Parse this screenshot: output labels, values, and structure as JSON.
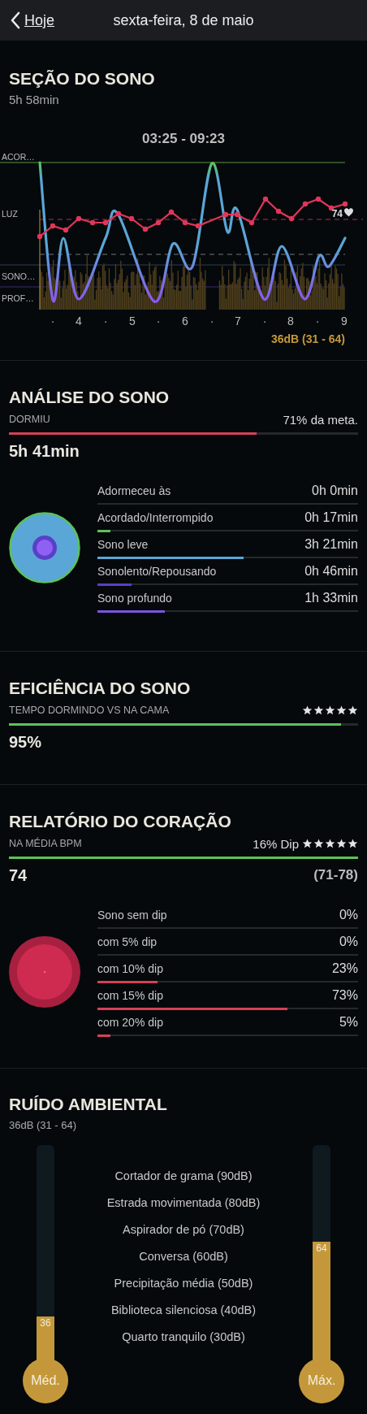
{
  "header": {
    "back": "Hoje",
    "title": "sexta-feira, 8 de maio"
  },
  "session": {
    "title": "SEÇÃO DO SONO",
    "duration": "5h 58min",
    "time_range": "03:25 - 09:23",
    "y_labels": [
      "ACOR…",
      "LUZ",
      "SONO…",
      "PROF…"
    ],
    "heart_rate_label": "74",
    "x_ticks": [
      "·",
      "4",
      "·",
      "5",
      "·",
      "6",
      "·",
      "7",
      "·",
      "8",
      "·",
      "9"
    ],
    "noise_label": "36dB (31 - 64)"
  },
  "analysis": {
    "title": "ANÁLISE DO SONO",
    "metric_label": "DORMIU",
    "goal": "71% da meta.",
    "level": 0.71,
    "value": "5h 41min",
    "stages": [
      {
        "label": "Adormeceu às",
        "value": "0h 0min"
      },
      {
        "label": "Acordado/Interrompido",
        "value": "0h 17min",
        "level": 0.05,
        "color": "#5cc25a"
      },
      {
        "label": "Sono leve",
        "value": "3h 21min",
        "level": 0.56,
        "color": "#5aa6d6"
      },
      {
        "label": "Sonolento/Repousando",
        "value": "0h 46min",
        "level": 0.13,
        "color": "#5a3fc8"
      },
      {
        "label": "Sono profundo",
        "value": "1h 33min",
        "level": 0.26,
        "color": "#7b55e0"
      }
    ]
  },
  "efficiency": {
    "title": "EFICIÊNCIA DO SONO",
    "metric_label": "TEMPO DORMINDO VS NA CAMA",
    "stars": 5,
    "level": 0.95,
    "value": "95%"
  },
  "heart": {
    "title": "RELATÓRIO DO CORAÇÃO",
    "metric_label": "NA MÉDIA BPM",
    "dip": "16% Dip",
    "stars": 5,
    "level": 1,
    "value": "74",
    "range": "(71-78)",
    "dips": [
      {
        "label": "Sono sem dip",
        "value": "0%",
        "level": 0
      },
      {
        "label": "com 5% dip",
        "value": "0%",
        "level": 0
      },
      {
        "label": "com 10% dip",
        "value": "23%",
        "level": 0.23
      },
      {
        "label": "com 15% dip",
        "value": "73%",
        "level": 0.73
      },
      {
        "label": "com 20% dip",
        "value": "5%",
        "level": 0.05
      }
    ]
  },
  "noise": {
    "title": "RUÍDO AMBIENTAL",
    "subtitle": "36dB (31 - 64)",
    "references": [
      "Cortador de grama (90dB)",
      "Estrada movimentada (80dB)",
      "Aspirador de pó (70dB)",
      "Conversa (60dB)",
      "Precipitação média (50dB)",
      "Biblioteca silenciosa (40dB)",
      "Quarto tranquilo (30dB)"
    ],
    "gauges": [
      {
        "label": "Méd.",
        "reading": "36",
        "level": 0.22
      },
      {
        "label": "Máx.",
        "reading": "64",
        "level": 0.56
      }
    ]
  }
}
